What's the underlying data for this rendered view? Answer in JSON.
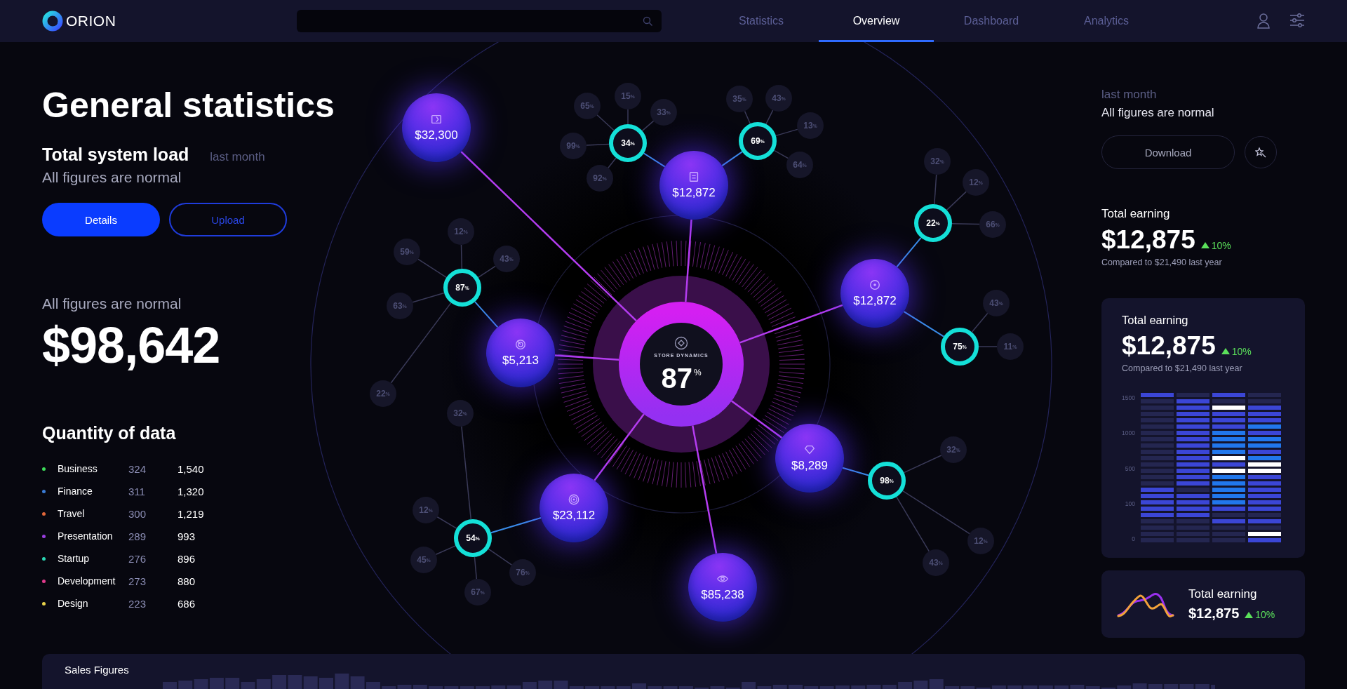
{
  "header": {
    "logo": "ORION",
    "tabs": [
      {
        "label": "Statistics",
        "selected": false
      },
      {
        "label": "Overview",
        "selected": true
      },
      {
        "label": "Dashboard",
        "selected": false
      },
      {
        "label": "Analytics",
        "selected": false
      }
    ]
  },
  "overview": {
    "title": "General statistics",
    "system_load": {
      "title": "Total system load",
      "period": "last month",
      "status": "All figures are normal"
    },
    "buttons": [
      {
        "label": "Details",
        "kind": "primary"
      },
      {
        "label": "Upload",
        "kind": "outline"
      }
    ],
    "summary": {
      "status": "All figures are normal",
      "amount": "$98,642"
    },
    "quantity": {
      "title": "Quantity of data",
      "rows": [
        {
          "name": "Business",
          "count": "324",
          "total": "1,540",
          "color": "#3ddc5a"
        },
        {
          "name": "Finance",
          "count": "311",
          "total": "1,320",
          "color": "#3a7bd5"
        },
        {
          "name": "Travel",
          "count": "300",
          "total": "1,219",
          "color": "#e2673a"
        },
        {
          "name": "Presentation",
          "count": "289",
          "total": "993",
          "color": "#9a3ee0"
        },
        {
          "name": "Startup",
          "count": "276",
          "total": "896",
          "color": "#2ad6b4"
        },
        {
          "name": "Development",
          "count": "273",
          "total": "880",
          "color": "#e03a8c"
        },
        {
          "name": "Design",
          "count": "223",
          "total": "686",
          "color": "#e8d24a"
        }
      ]
    }
  },
  "diagram": {
    "center": {
      "label": "STORE DYNAMICS",
      "value": "87",
      "unit": "%"
    },
    "nodes": [
      {
        "amount": "$32,300"
      },
      {
        "amount": "$12,872",
        "rings": [
          {
            "value": "34",
            "unit": "%",
            "satellites": [
              {
                "value": "65",
                "unit": "%"
              },
              {
                "value": "15",
                "unit": "%"
              },
              {
                "value": "33",
                "unit": "%"
              },
              {
                "value": "99",
                "unit": "%"
              },
              {
                "value": "92",
                "unit": "%"
              }
            ]
          },
          {
            "value": "69",
            "unit": "%",
            "satellites": [
              {
                "value": "35",
                "unit": "%"
              },
              {
                "value": "43",
                "unit": "%"
              },
              {
                "value": "13",
                "unit": "%"
              },
              {
                "value": "64",
                "unit": "%"
              }
            ]
          }
        ]
      },
      {
        "amount": "$12,872",
        "rings": [
          {
            "value": "22",
            "unit": "%",
            "satellites": [
              {
                "value": "32",
                "unit": "%"
              },
              {
                "value": "12",
                "unit": "%"
              },
              {
                "value": "66",
                "unit": "%"
              }
            ]
          },
          {
            "value": "75",
            "unit": "%",
            "satellites": [
              {
                "value": "43",
                "unit": "%"
              },
              {
                "value": "11",
                "unit": "%"
              }
            ]
          }
        ]
      },
      {
        "amount": "$5,213",
        "rings": [
          {
            "value": "87",
            "unit": "%",
            "satellites": [
              {
                "value": "12",
                "unit": "%"
              },
              {
                "value": "59",
                "unit": "%"
              },
              {
                "value": "43",
                "unit": "%"
              },
              {
                "value": "63",
                "unit": "%"
              },
              {
                "value": "22",
                "unit": "%"
              }
            ]
          }
        ]
      },
      {
        "amount": "$8,289",
        "rings": [
          {
            "value": "98",
            "unit": "%",
            "satellites": [
              {
                "value": "32",
                "unit": "%"
              },
              {
                "value": "12",
                "unit": "%"
              },
              {
                "value": "43",
                "unit": "%"
              }
            ]
          }
        ]
      },
      {
        "amount": "$23,112",
        "rings": [
          {
            "value": "54",
            "unit": "%",
            "satellites": [
              {
                "value": "32",
                "unit": "%"
              },
              {
                "value": "12",
                "unit": "%"
              },
              {
                "value": "45",
                "unit": "%"
              },
              {
                "value": "67",
                "unit": "%"
              },
              {
                "value": "76",
                "unit": "%"
              }
            ]
          }
        ]
      },
      {
        "amount": "$85,238"
      }
    ]
  },
  "side": {
    "period": "last month",
    "status": "All figures are normal",
    "download": "Download",
    "earning": {
      "title": "Total earning",
      "amount": "$12,875",
      "change": "10%",
      "compare": "Compared to $21,490 last year"
    },
    "card": {
      "title": "Total earning",
      "amount": "$12,875",
      "change": "10%",
      "compare": "Compared to $21,490 last year",
      "axis_labels": [
        "1500",
        "1000",
        "500",
        "100",
        "0"
      ]
    },
    "mini_card": {
      "title": "Total earning",
      "amount": "$12,875",
      "change": "10%"
    }
  },
  "sales": {
    "title": "Sales Figures"
  }
}
